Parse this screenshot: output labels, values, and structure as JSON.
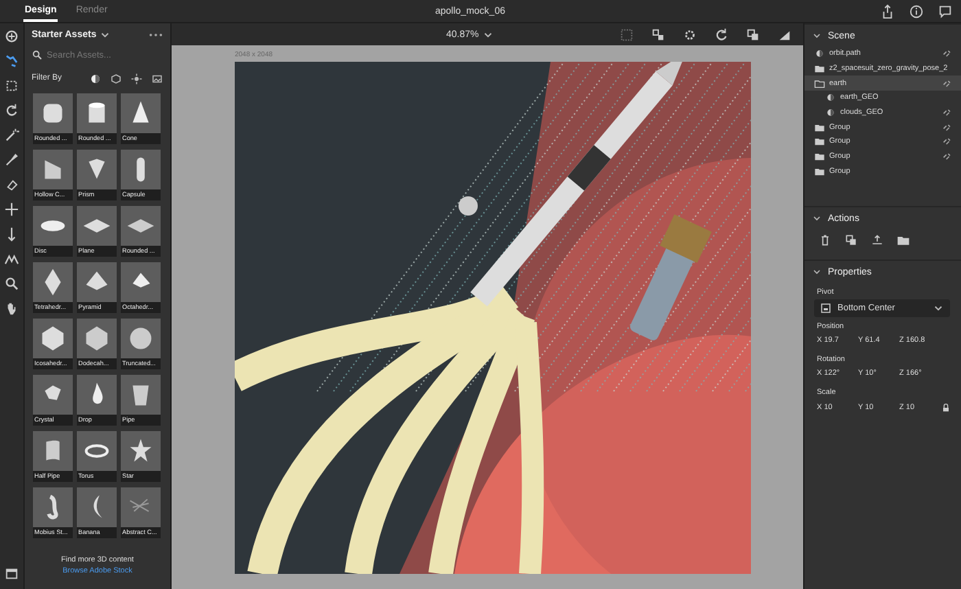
{
  "tabs": [
    {
      "label": "Design",
      "selected": true
    },
    {
      "label": "Render",
      "selected": false
    }
  ],
  "document_title": "apollo_mock_06",
  "assets": {
    "title": "Starter Assets",
    "search": {
      "placeholder": "Search Assets..."
    },
    "filter_label": "Filter By",
    "items": [
      "Rounded ...",
      "Rounded ...",
      "Cone",
      "Hollow C...",
      "Prism",
      "Capsule",
      "Disc",
      "Plane",
      "Rounded ...",
      "Tetrahedr...",
      "Pyramid",
      "Octahedr...",
      "Icosahedr...",
      "Dodecah...",
      "Truncated...",
      "Crystal",
      "Drop",
      "Pipe",
      "Half Pipe",
      "Torus",
      "Star",
      "Mobius St...",
      "Banana",
      "Abstract C..."
    ],
    "footer_text": "Find more 3D content",
    "footer_link": "Browse Adobe Stock"
  },
  "canvas": {
    "zoom": "40.87%",
    "size_label": "2048 x 2048"
  },
  "scene": {
    "title": "Scene",
    "items": [
      {
        "name": "orbit.path",
        "kind": "object",
        "selected": false,
        "linked": true
      },
      {
        "name": "z2_spacesuit_zero_gravity_pose_2",
        "kind": "folder",
        "expanded": false,
        "selected": false,
        "linked": false
      },
      {
        "name": "earth",
        "kind": "folder",
        "expanded": true,
        "selected": true,
        "linked": true,
        "children": [
          {
            "name": "earth_GEO",
            "kind": "object",
            "selected": false,
            "linked": false
          },
          {
            "name": "clouds_GEO",
            "kind": "object",
            "selected": false,
            "linked": true
          }
        ]
      },
      {
        "name": "Group",
        "kind": "folder",
        "expanded": false,
        "selected": false,
        "linked": true
      },
      {
        "name": "Group",
        "kind": "folder",
        "expanded": false,
        "selected": false,
        "linked": true
      },
      {
        "name": "Group",
        "kind": "folder",
        "expanded": false,
        "selected": false,
        "linked": true
      },
      {
        "name": "Group",
        "kind": "folder",
        "expanded": false,
        "selected": false,
        "linked": false
      }
    ]
  },
  "actions": {
    "title": "Actions"
  },
  "properties": {
    "title": "Properties",
    "pivot_label": "Pivot",
    "pivot": "Bottom Center",
    "groups": [
      {
        "label": "Position",
        "fields": [
          {
            "axis": "X",
            "value": "19.7"
          },
          {
            "axis": "Y",
            "value": "61.4"
          },
          {
            "axis": "Z",
            "value": "160.8"
          }
        ]
      },
      {
        "label": "Rotation",
        "fields": [
          {
            "axis": "X",
            "value": "122°"
          },
          {
            "axis": "Y",
            "value": "10°"
          },
          {
            "axis": "Z",
            "value": "166°"
          }
        ]
      },
      {
        "label": "Scale",
        "fields": [
          {
            "axis": "X",
            "value": "10"
          },
          {
            "axis": "Y",
            "value": "10"
          },
          {
            "axis": "Z",
            "value": "10"
          }
        ],
        "locked": true
      }
    ]
  }
}
